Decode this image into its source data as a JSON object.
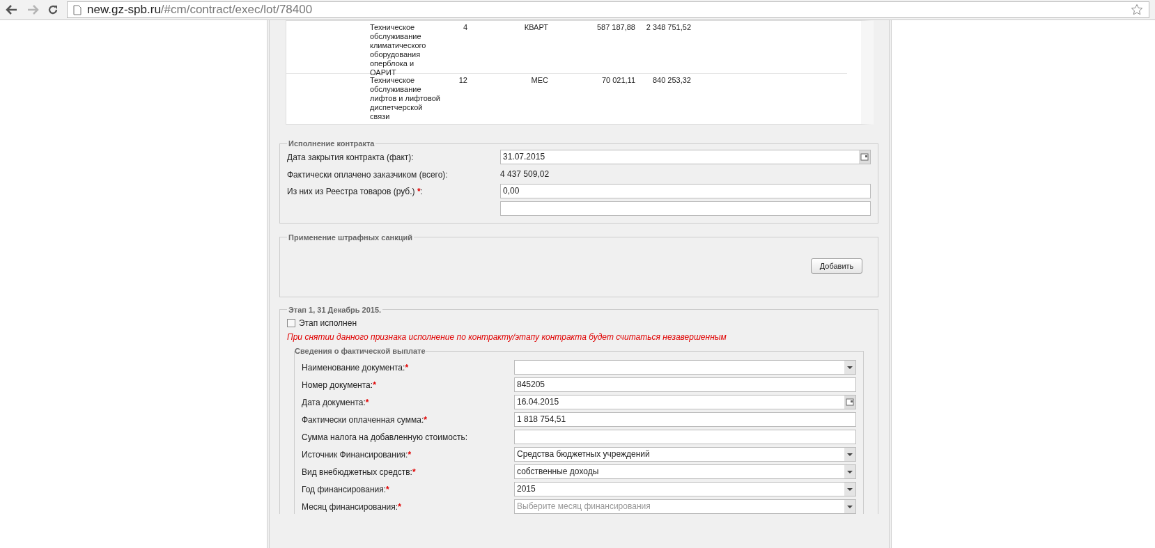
{
  "browser": {
    "url_host": "new.gz-spb.ru",
    "url_path": "/#cm/contract/exec/lot/78400"
  },
  "items_table": {
    "rows": [
      {
        "name": "Техническое обслуживание климатического оборудования оперблока и ОАРИТ",
        "quantity": "4",
        "unit": "КВАРТ",
        "price": "587 187,88",
        "total": "2 348 751,52"
      },
      {
        "name": "Техническое обслуживание лифтов и лифтовой диспетчерской связи",
        "quantity": "12",
        "unit": "МЕС",
        "price": "70 021,11",
        "total": "840 253,32"
      }
    ]
  },
  "execution": {
    "legend": "Исполнение контракта",
    "fields": [
      {
        "kind": "date",
        "label": "Дата закрытия контракта (факт):",
        "value": "31.07.2015"
      },
      {
        "kind": "readonly",
        "label": "Фактически оплачено заказчиком (всего):",
        "value": "4 437 509,02"
      },
      {
        "kind": "input",
        "label": "Из них из Реестра товаров (руб.) ",
        "marker": "*",
        "label_end": ":",
        "value": "0,00"
      },
      {
        "kind": "input"
      }
    ]
  },
  "penalties": {
    "legend": "Применение штрафных санкций",
    "button": "Добавить"
  },
  "stage": {
    "legend": "Этап 1, 31 Декабрь 2015.",
    "completed": {
      "label": "Этап исполнен",
      "checked": false
    },
    "warning": "При снятии данного признака исполнение по контракту/этапу контракта будет считаться незавершенным",
    "payment": {
      "legend": "Сведения о фактической выплате",
      "fields": [
        {
          "kind": "select",
          "label": "Наименование документа:",
          "marker": "*"
        },
        {
          "kind": "input",
          "label": "Номер документа:",
          "marker": "*",
          "value": "845205"
        },
        {
          "kind": "date",
          "label": "Дата документа:",
          "marker": "*",
          "value": "16.04.2015"
        },
        {
          "kind": "input",
          "label": "Фактически оплаченная сумма:",
          "marker": "*",
          "value": "1 818 754,51"
        },
        {
          "kind": "input",
          "label": "Сумма налога на добавленную стоимость:"
        },
        {
          "kind": "select",
          "label": "Источник Финансирования:",
          "marker": "*",
          "value": "Средства бюджетных учреждений"
        },
        {
          "kind": "select",
          "label": "Вид внебюджетных средств:",
          "marker": "*",
          "value": "собственные доходы"
        },
        {
          "kind": "select",
          "label": "Год финансирования:",
          "marker": "*",
          "value": "2015"
        },
        {
          "kind": "select",
          "label": "Месяц финансирования:",
          "marker": "*",
          "placeholder": "Выберите месяц финансирования"
        }
      ]
    }
  }
}
